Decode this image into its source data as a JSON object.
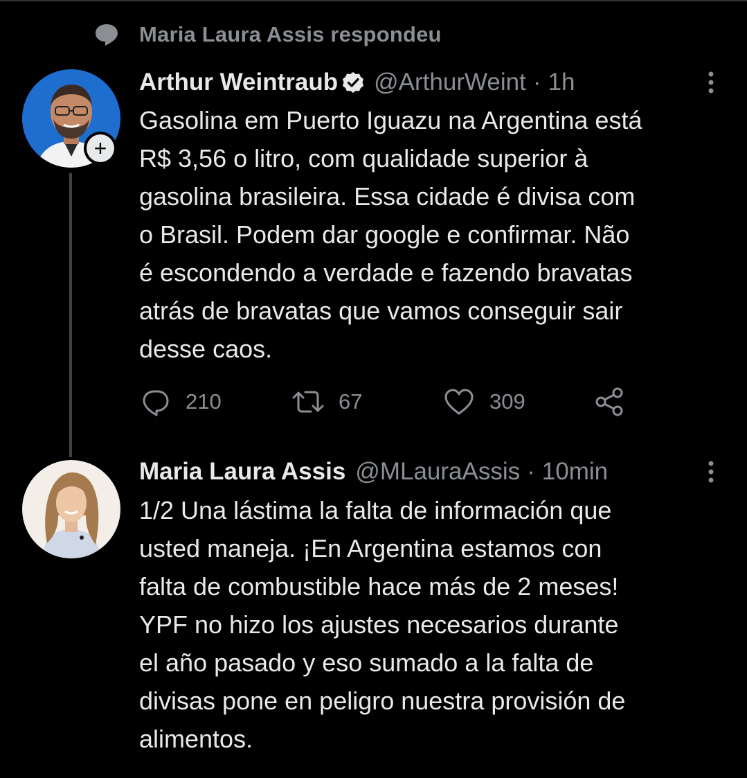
{
  "context": {
    "icon": "speech-bubble-icon",
    "text": "Maria Laura Assis respondeu"
  },
  "tweets": [
    {
      "author_name": "Arthur Weintraub",
      "verified": true,
      "handle": "@ArthurWeint",
      "separator": "·",
      "time": "1h",
      "follow_badge": "+",
      "text": "Gasolina em Puerto Iguazu na Argentina está\nR$ 3,56 o litro, com qualidade superior à\ngasolina brasileira. Essa cidade é divisa com\no Brasil. Podem dar google e confirmar. Não\né escondendo a verdade e fazendo bravatas\natrás de bravatas que vamos conseguir sair\ndesse caos.",
      "actions": {
        "replies": "210",
        "retweets": "67",
        "likes": "309"
      },
      "avatar_bg": "#1d6fd1"
    },
    {
      "author_name": "Maria Laura Assis",
      "handle": "@MLauraAssis",
      "separator": "·",
      "time": "10min",
      "text": "1/2 Una lástima la falta de información que\nusted maneja. ¡En Argentina estamos con\nfalta de combustible hace más de 2 meses!\nYPF no hizo los ajustes necesarios durante\nel año pasado y eso sumado a la falta de\ndivisas pone en peligro nuestra provisión de\nalimentos.",
      "avatar_bg": "#f3efe8"
    }
  ],
  "colors": {
    "background": "#000000",
    "primary_text": "#e7e9ea",
    "secondary_text": "#8b8f94",
    "thread_line": "#3e4144"
  }
}
